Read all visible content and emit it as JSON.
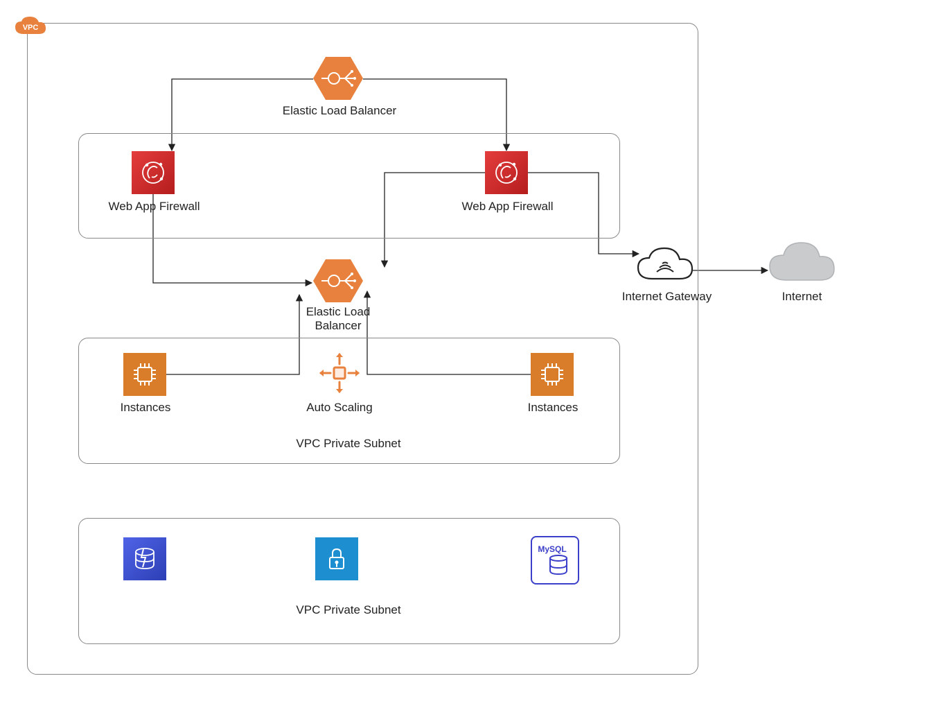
{
  "vpc_badge": "VPC",
  "nodes": {
    "elb_top": "Elastic Load Balancer",
    "waf_left": "Web App Firewall",
    "waf_right": "Web App Firewall",
    "elb_mid": "Elastic Load\nBalancer",
    "instances_left": "Instances",
    "autoscaling": "Auto Scaling",
    "instances_right": "Instances",
    "subnet_mid": "VPC Private Subnet",
    "subnet_bottom": "VPC Private Subnet",
    "igw": "Internet Gateway",
    "internet": "Internet",
    "mysql": "MySQL"
  },
  "colors": {
    "aws_orange": "#e8813d",
    "aws_red_a": "#e43d3d",
    "aws_red_b": "#b51d1d",
    "ec2_orange": "#d97d2a",
    "security_blue": "#1d8fd1",
    "cache_indigo": "#4458d6",
    "rds_purple": "#3b3fc9",
    "cloud_fill": "#c9cbcd",
    "stroke": "#222"
  },
  "diagram": {
    "container": "VPC",
    "subnets": [
      {
        "name": "waf-row",
        "contains": [
          "Web App Firewall",
          "Web App Firewall"
        ]
      },
      {
        "name": "VPC Private Subnet",
        "contains": [
          "Instances",
          "Auto Scaling",
          "Instances"
        ]
      },
      {
        "name": "VPC Private Subnet",
        "contains": [
          "ElastiCache",
          "Lock",
          "MySQL"
        ]
      }
    ],
    "edges": [
      [
        "Elastic Load Balancer (top)",
        "Web App Firewall (left)"
      ],
      [
        "Elastic Load Balancer (top)",
        "Web App Firewall (right)"
      ],
      [
        "Web App Firewall (left)",
        "Elastic Load Balancer (mid)"
      ],
      [
        "Web App Firewall (right)",
        "Elastic Load Balancer (mid)"
      ],
      [
        "Web App Firewall (right)",
        "Internet Gateway"
      ],
      [
        "Instances (left)",
        "Elastic Load Balancer (mid)"
      ],
      [
        "Instances (right)",
        "Elastic Load Balancer (mid)"
      ],
      [
        "Internet Gateway",
        "Internet"
      ]
    ]
  }
}
